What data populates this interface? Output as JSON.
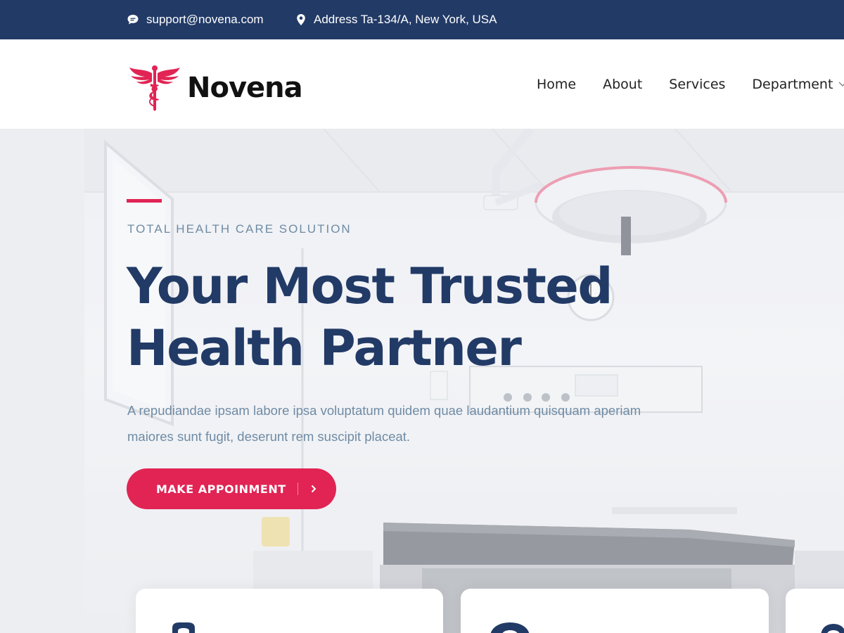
{
  "topbar": {
    "email": "support@novena.com",
    "address": "Address Ta-134/A, New York, USA",
    "email_icon": "chat-bubble-icon",
    "address_icon": "map-marker-icon"
  },
  "header": {
    "logo_text": "Novena",
    "logo_icon": "caduceus-icon",
    "nav": [
      {
        "label": "Home"
      },
      {
        "label": "About"
      },
      {
        "label": "Services"
      },
      {
        "label": "Department"
      }
    ]
  },
  "hero": {
    "eyebrow": "TOTAL HEALTH CARE SOLUTION",
    "title": "Your Most Trusted Health Partner",
    "description": "A repudiandae ipsam labore ipsa voluptatum quidem quae laudantium quisquam aperiam maiores sunt fugit, deserunt rem suscipit placeat.",
    "cta_label": "MAKE APPOINMENT",
    "cta_icon": "chevron-right-icon"
  },
  "colors": {
    "navy": "#223a66",
    "accent": "#e12454",
    "muted": "#6f8ba4"
  }
}
